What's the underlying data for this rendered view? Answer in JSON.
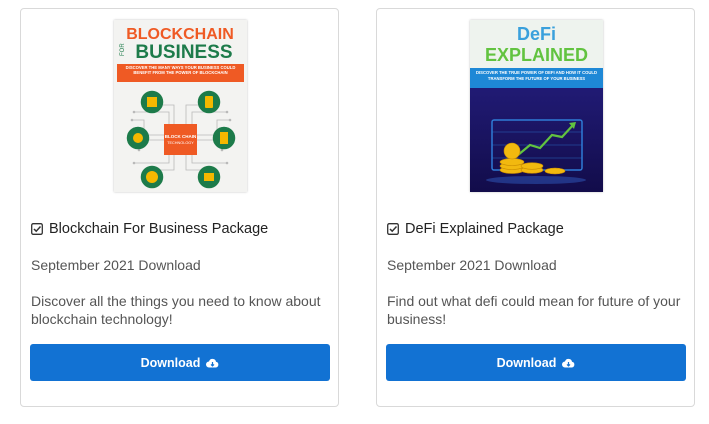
{
  "products": [
    {
      "title": "Blockchain For Business Package",
      "date": "September 2021 Download",
      "description": "Discover all the things you need to know about blockchain technology!",
      "button_label": "Download",
      "cover": {
        "title_line1": "BLOCKCHAIN",
        "title_side": "FOR",
        "title_line2": "BUSINESS",
        "subtitle": "DISCOVER THE MANY WAYS YOUR BUSINESS COULD BENEFIT FROM THE POWER OF BLOCKCHAIN",
        "center_label_1": "BLOCK CHAIN",
        "center_label_2": "TECHNOLOGY"
      }
    },
    {
      "title": "DeFi Explained Package",
      "date": "September 2021 Download",
      "description": "Find out what defi could mean for future of your business!",
      "button_label": "Download",
      "cover": {
        "title_line1": "DeFi",
        "title_line2": "EXPLAINED",
        "subtitle": "DISCOVER THE TRUE POWER OF DEFI AND HOW IT COULD TRANSFORM THE FUTURE OF YOUR BUSINESS"
      }
    }
  ],
  "colors": {
    "button": "#1272d3",
    "card_border": "#d9d9d9",
    "cover1_orange": "#ef5a24",
    "cover1_green": "#1d7b4a",
    "cover2_green": "#62c340",
    "cover2_bg": "#1d1470"
  },
  "icons": [
    "check-square-icon",
    "cloud-download-icon"
  ]
}
